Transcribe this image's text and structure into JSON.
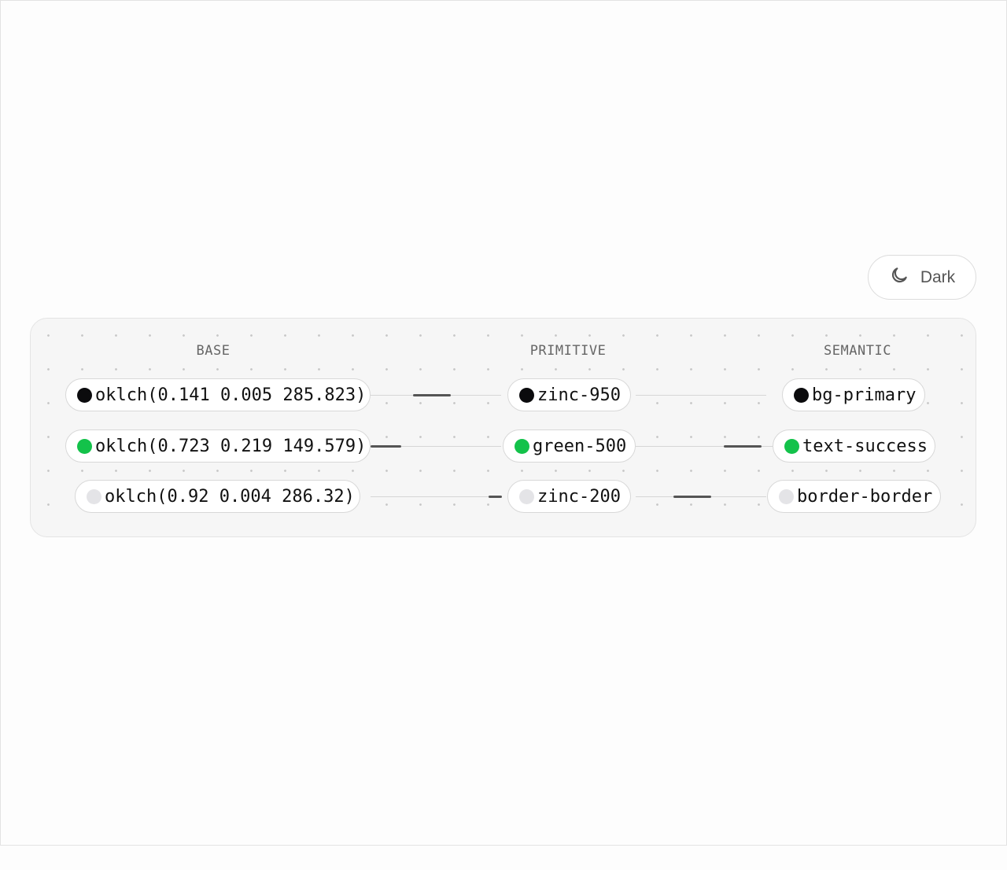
{
  "theme_toggle": {
    "label": "Dark",
    "icon": "moon-icon"
  },
  "columns": {
    "base": "BASE",
    "primitive": "PRIMITIVE",
    "semantic": "SEMANTIC"
  },
  "rows": [
    {
      "base": "oklch(0.141 0.005 285.823)",
      "primitive": "zinc-950",
      "semantic": "bg-primary",
      "color": "#0b0b0d"
    },
    {
      "base": "oklch(0.723 0.219 149.579)",
      "primitive": "green-500",
      "semantic": "text-success",
      "color": "#13c24a"
    },
    {
      "base": "oklch(0.92 0.004 286.32)",
      "primitive": "zinc-200",
      "semantic": "border-border",
      "color": "#e4e4e7"
    }
  ],
  "colors": {
    "canvas_bg": "#f6f6f6",
    "edge": "#d6d6d6",
    "edge_flow": "#555555"
  }
}
